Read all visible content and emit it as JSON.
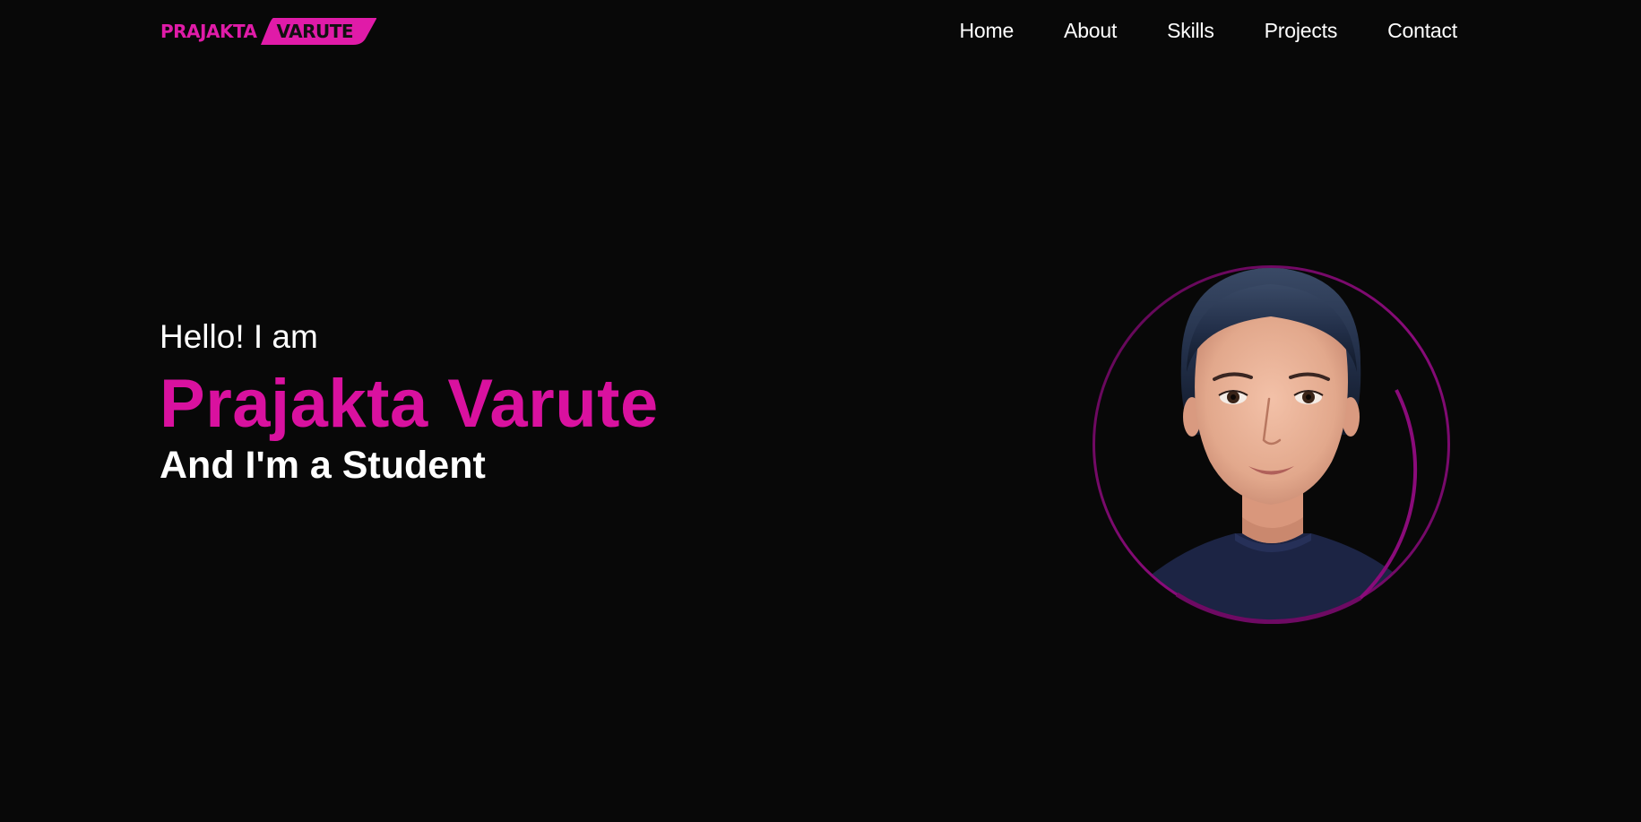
{
  "header": {
    "logo": {
      "first": "PRAJAKTA",
      "second": "VARUTE"
    },
    "nav": [
      {
        "label": "Home"
      },
      {
        "label": "About"
      },
      {
        "label": "Skills"
      },
      {
        "label": "Projects"
      },
      {
        "label": "Contact"
      }
    ]
  },
  "hero": {
    "greeting": "Hello! I am",
    "name": "Prajakta Varute",
    "role": "And I'm a Student",
    "profile_image": "profile-photo"
  },
  "colors": {
    "background": "#080808",
    "accent": "#d9119f",
    "ring": "#7a0a6e"
  }
}
